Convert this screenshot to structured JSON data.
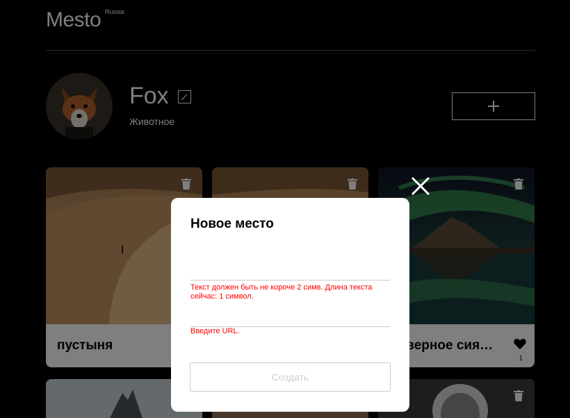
{
  "header": {
    "logo": "Mesto",
    "logo_sup": "Russia"
  },
  "profile": {
    "name": "Fox",
    "about": "Животное"
  },
  "cards": [
    {
      "title": "пустыня",
      "likes": ""
    },
    {
      "title": "",
      "likes": ""
    },
    {
      "title": "Северное сияние",
      "likes": "1"
    }
  ],
  "popup": {
    "title": "Новое место",
    "name_value": "",
    "name_placeholder": "",
    "name_error": "Текст должен быть не короче 2 симв. Длина текста сейчас: 1 символ.",
    "link_value": "",
    "link_placeholder": "",
    "link_error": "Введите URL.",
    "submit_label": "Создать"
  },
  "colors": {
    "error": "#ff0000",
    "background": "#000000",
    "card": "#ffffff"
  }
}
